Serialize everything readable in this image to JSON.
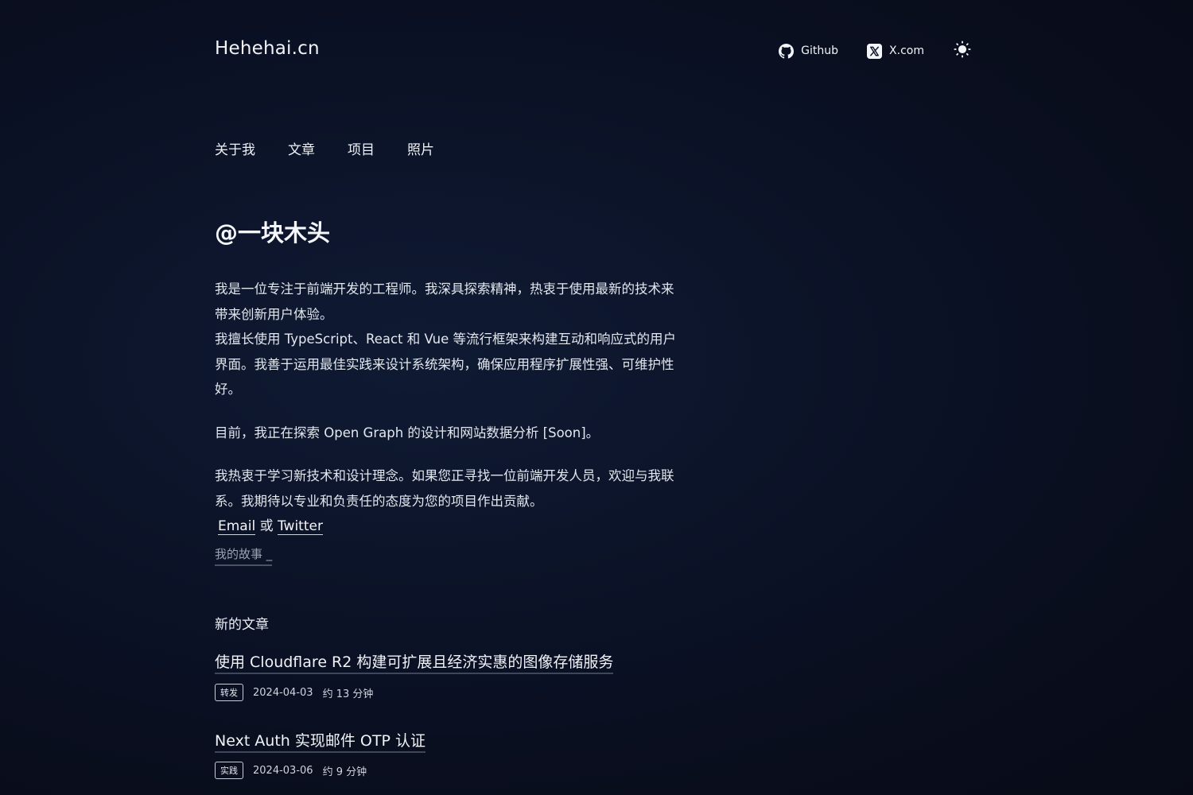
{
  "header": {
    "site_title": "Hehehai.cn",
    "links": [
      {
        "label": "Github",
        "icon": "github-icon"
      },
      {
        "label": "X.com",
        "icon": "x-icon"
      }
    ],
    "theme_toggle_icon": "sun-icon"
  },
  "nav": {
    "items": [
      {
        "label": "关于我"
      },
      {
        "label": "文章"
      },
      {
        "label": "项目"
      },
      {
        "label": "照片"
      }
    ]
  },
  "intro": {
    "heading": "@一块木头",
    "p1": "我是一位专注于前端开发的工程师。我深具探索精神，热衷于使用最新的技术来带来创新用户体验。",
    "p2": "我擅长使用 TypeScript、React 和 Vue 等流行框架来构建互动和响应式的用户界面。我善于运用最佳实践来设计系统架构，确保应用程序扩展性强、可维护性好。",
    "p3": "目前，我正在探索 Open Graph 的设计和网站数据分析 [Soon]。",
    "p4": "我热衷于学习新技术和设计理念。如果您正寻找一位前端开发人员，欢迎与我联系。我期待以专业和负责任的态度为您的项目作出贡献。",
    "email_label": "Email",
    "or_label": "或",
    "twitter_label": "Twitter",
    "story_label": "我的故事 _"
  },
  "articles": {
    "section_title": "新的文章",
    "items": [
      {
        "title": "使用 Cloudflare R2 构建可扩展且经济实惠的图像存储服务",
        "tag": "转发",
        "date": "2024-04-03",
        "read_time": "约 13 分钟"
      },
      {
        "title": "Next Auth 实现邮件 OTP 认证",
        "tag": "实践",
        "date": "2024-03-06",
        "read_time": "约 9 分钟"
      }
    ]
  },
  "colors": {
    "background": "#0b1226",
    "text": "#e8ebf2",
    "muted": "#9aa3b3"
  }
}
